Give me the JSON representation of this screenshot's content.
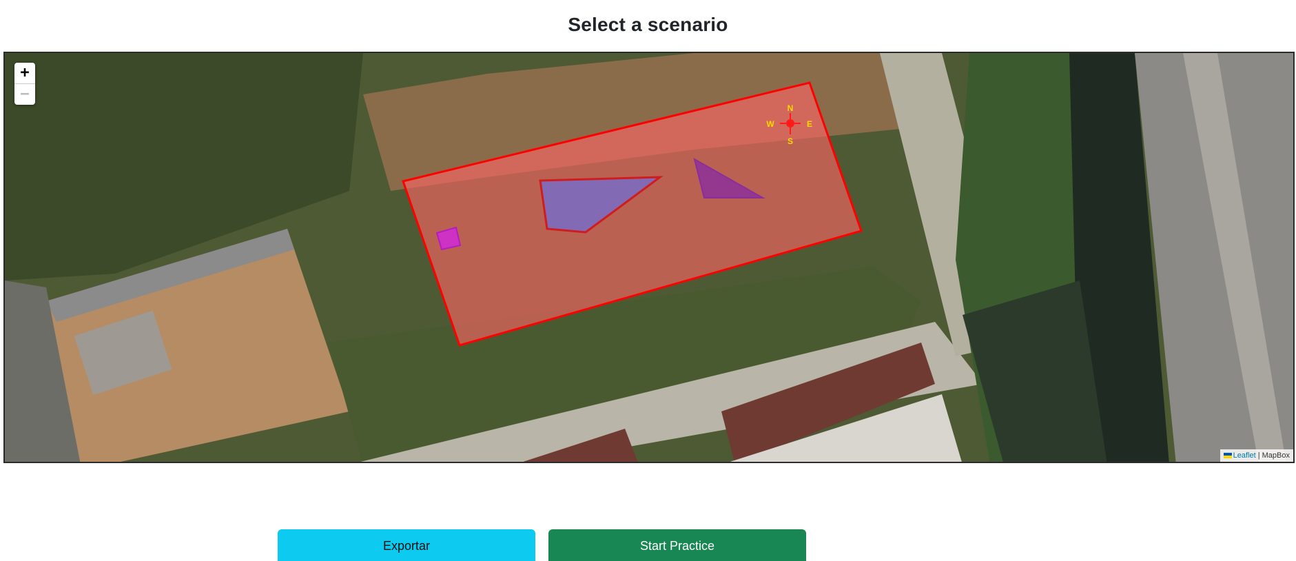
{
  "page": {
    "title": "Select a scenario"
  },
  "map": {
    "zoom_in_label": "+",
    "zoom_out_label": "−",
    "compass": {
      "north": "N",
      "south": "S",
      "east": "E",
      "west": "W"
    },
    "attribution": {
      "leaflet": "Leaflet",
      "separator": " | ",
      "provider": "MapBox"
    },
    "shapes": [
      {
        "name": "field-polygon",
        "color": "#ff0000"
      },
      {
        "name": "blue-obstacle",
        "color": "#6f6fd6"
      },
      {
        "name": "purple-obstacle",
        "color": "#8b2e9c"
      },
      {
        "name": "magenta-marker",
        "color": "#d02ad8"
      }
    ]
  },
  "actions": {
    "export_label": "Exportar",
    "start_label": "Start Practice"
  },
  "colors": {
    "export_button": "#0dcaf0",
    "start_button": "#198754"
  }
}
